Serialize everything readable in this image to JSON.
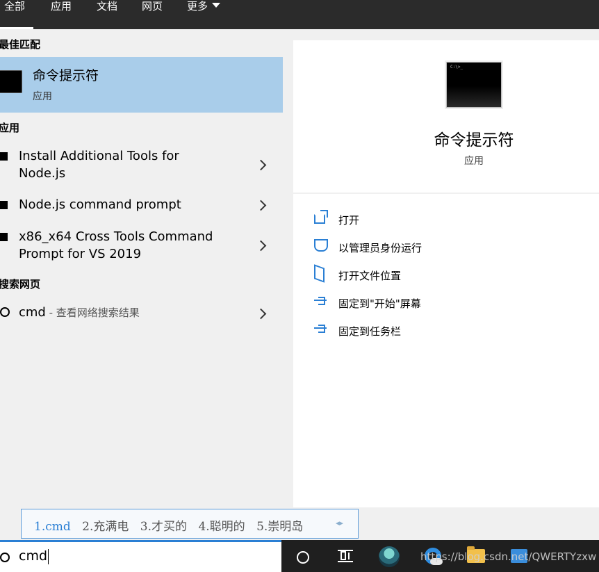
{
  "tabs": [
    {
      "label": "全部",
      "active": true
    },
    {
      "label": "应用"
    },
    {
      "label": "文档"
    },
    {
      "label": "网页"
    },
    {
      "label": "更多"
    }
  ],
  "sections": {
    "best_match": "最佳匹配",
    "apps": "应用",
    "web": "搜索网页"
  },
  "best_match": {
    "title": "命令提示符",
    "subtitle": "应用",
    "icon": "cmd-icon"
  },
  "apps": [
    {
      "line1": "Install Additional Tools for",
      "line2": "Node.js"
    },
    {
      "line1": "Node.js command prompt",
      "line2": ""
    },
    {
      "line1": "x86_x64 Cross Tools Command",
      "line2": "Prompt for VS 2019"
    }
  ],
  "web_result": {
    "query": "cmd",
    "suffix": " - 查看网络搜索结果"
  },
  "ime": {
    "candidates": [
      "1.cmd",
      "2.充满电",
      "3.才买的",
      "4.聪明的",
      "5.崇明岛"
    ],
    "arrows": "◂▸"
  },
  "search": {
    "value": "cmd"
  },
  "detail": {
    "title": "命令提示符",
    "subtitle": "应用",
    "actions": [
      {
        "label": "打开",
        "icon": "open-icon"
      },
      {
        "label": "以管理员身份运行",
        "icon": "shield-icon"
      },
      {
        "label": "打开文件位置",
        "icon": "file-location-icon"
      },
      {
        "label": "固定到\"开始\"屏幕",
        "icon": "pin-icon"
      },
      {
        "label": "固定到任务栏",
        "icon": "pin-icon"
      }
    ]
  },
  "taskbar": {
    "watermark": "https://blog.csdn.net/QWERTYzxw"
  },
  "colors": {
    "accent": "#2a7fd4",
    "selected": "#a9cdea",
    "topbar": "#2b2b2b",
    "taskbar": "#1f1f1f"
  }
}
